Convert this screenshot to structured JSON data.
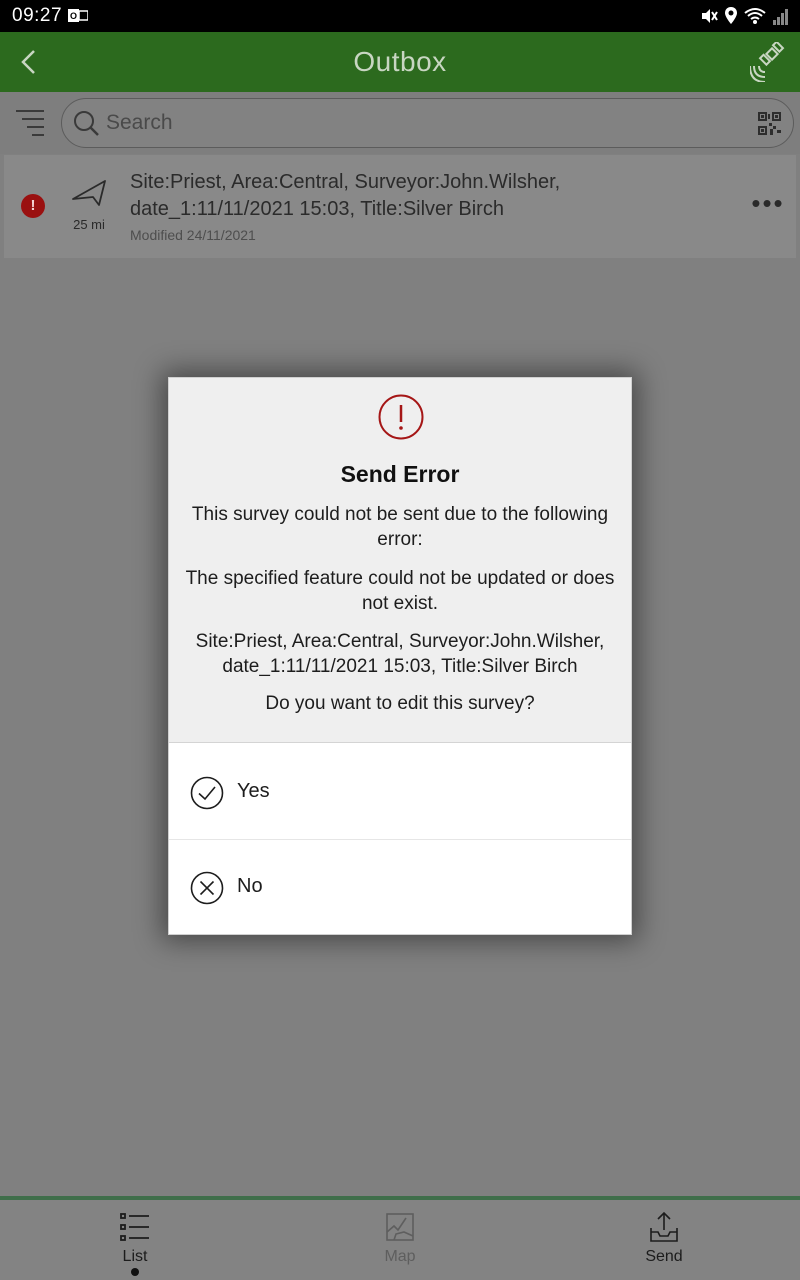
{
  "status_bar": {
    "time": "09:27",
    "icons": [
      "outlook-icon",
      "mute-icon",
      "location-icon",
      "wifi-icon",
      "signal-icon"
    ]
  },
  "header": {
    "title": "Outbox",
    "back_icon": "chevron-left-icon",
    "right_icon": "satellite-icon"
  },
  "search": {
    "placeholder": "Search",
    "value": "",
    "left_icon": "filter-icon",
    "right_icon": "qr-code-icon"
  },
  "list": {
    "items": [
      {
        "status_icon": "error-icon",
        "status_glyph": "!",
        "direction_icon": "navigation-arrow-icon",
        "distance": "25 mi",
        "line1": "Site:Priest, Area:Central, Surveyor:John.Wilsher,",
        "line2": "date_1:11/11/2021 15:03, Title:Silver Birch",
        "modified": "Modified 24/11/2021",
        "more": "•••"
      }
    ]
  },
  "dialog": {
    "icon": "alert-circle-icon",
    "title": "Send Error",
    "message1": "This survey could not be sent due to the following error:",
    "message2": "The specified feature could not be updated or does not exist.",
    "message3": "Site:Priest, Area:Central, Surveyor:John.Wilsher, date_1:11/11/2021 15:03, Title:Silver Birch",
    "question": "Do you want to edit this survey?",
    "yes_label": "Yes",
    "no_label": "No"
  },
  "bottom_nav": {
    "tabs": [
      {
        "label": "List",
        "icon": "list-icon",
        "active": true
      },
      {
        "label": "Map",
        "icon": "map-icon",
        "active": false
      },
      {
        "label": "Send",
        "icon": "send-icon",
        "active": false
      }
    ]
  },
  "colors": {
    "header_green": "#2c6a1e",
    "error_red": "#9a1010",
    "scrim_gray": "#808080"
  }
}
